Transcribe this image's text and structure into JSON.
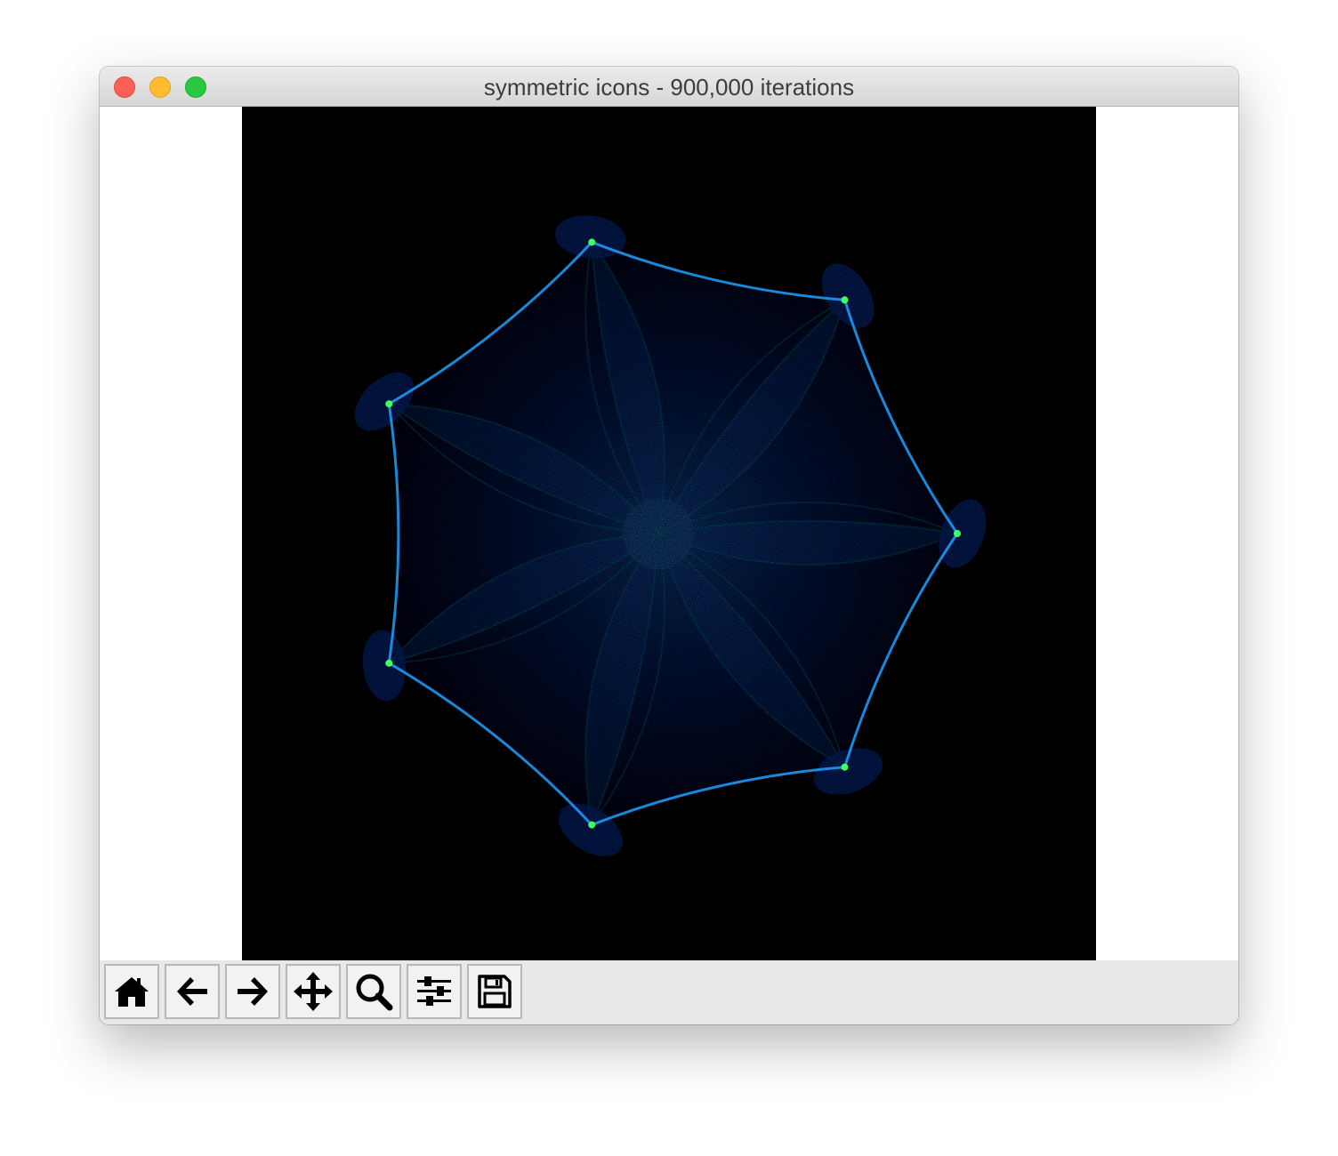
{
  "window": {
    "title": "symmetric icons - 900,000 iterations"
  },
  "figure": {
    "description_colors": {
      "background": "#000000",
      "primary": "#0050ff",
      "highlight": "#00e0ff",
      "peak": "#40ff60"
    },
    "symmetry": 7
  },
  "toolbar": {
    "buttons": [
      {
        "name": "home-button",
        "icon": "home-icon"
      },
      {
        "name": "back-button",
        "icon": "arrow-left-icon"
      },
      {
        "name": "forward-button",
        "icon": "arrow-right-icon"
      },
      {
        "name": "pan-button",
        "icon": "move-icon"
      },
      {
        "name": "zoom-button",
        "icon": "magnifier-icon"
      },
      {
        "name": "configure-subplots-button",
        "icon": "sliders-icon"
      },
      {
        "name": "save-button",
        "icon": "floppy-disk-icon"
      }
    ]
  }
}
